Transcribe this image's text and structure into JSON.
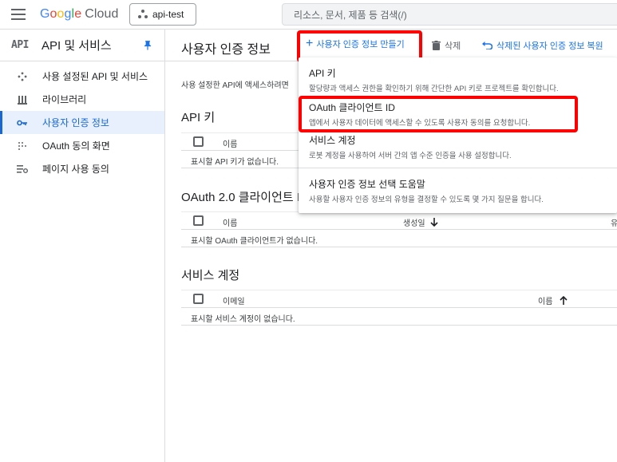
{
  "topbar": {
    "logo_parts": [
      "G",
      "o",
      "o",
      "g",
      "l",
      "e"
    ],
    "logo_suffix": "Cloud",
    "project": "api-test",
    "search_placeholder": "리소스, 문서, 제품 등 검색(/)"
  },
  "sidebar": {
    "badge": "API",
    "title": "API 및 서비스",
    "items": [
      {
        "label": "사용 설정된 API 및 서비스",
        "icon": "settings-api-icon"
      },
      {
        "label": "라이브러리",
        "icon": "library-icon"
      },
      {
        "label": "사용자 인증 정보",
        "icon": "key-icon",
        "active": true
      },
      {
        "label": "OAuth 동의 화면",
        "icon": "consent-icon"
      },
      {
        "label": "페이지 사용 동의",
        "icon": "page-consent-icon"
      }
    ]
  },
  "main": {
    "title": "사용자 인증 정보",
    "create_label": "사용자 인증 정보 만들기",
    "delete_label": "삭제",
    "restore_label": "삭제된 사용자 인증 정보 복원",
    "intro": "사용 설정한 API에 액세스하려면",
    "api_keys": {
      "title": "API 키",
      "col_name": "이름",
      "empty": "표시할 API 키가 없습니다."
    },
    "oauth": {
      "title": "OAuth 2.0 클라이언트 I",
      "col_name": "이름",
      "col_created": "생성일",
      "col_type": "유",
      "empty": "표시할 OAuth 클라이언트가 없습니다."
    },
    "service": {
      "title": "서비스 계정",
      "col_email": "이메일",
      "col_name": "이름",
      "empty": "표시할 서비스 계정이 없습니다."
    }
  },
  "dropdown": {
    "items": [
      {
        "title": "API 키",
        "desc": "할당량과 액세스 권한을 확인하기 위해 간단한 API 키로 프로젝트를 확인합니다."
      },
      {
        "title": "OAuth 클라이언트 ID",
        "desc": "앱에서 사용자 데이터에 액세스할 수 있도록 사용자 동의를 요청합니다."
      },
      {
        "title": "서비스 계정",
        "desc": "로봇 계정을 사용하여 서버 간의 앱 수준 인증을 사용 설정합니다."
      },
      {
        "title": "사용자 인증 정보 선택 도움말",
        "desc": "사용할 사용자 인증 정보의 유형을 결정할 수 있도록 몇 가지 질문을 합니다."
      }
    ]
  },
  "colors": {
    "accent": "#1a73e8",
    "highlight": "#ff0000",
    "active_bg": "#e8f0fe"
  }
}
